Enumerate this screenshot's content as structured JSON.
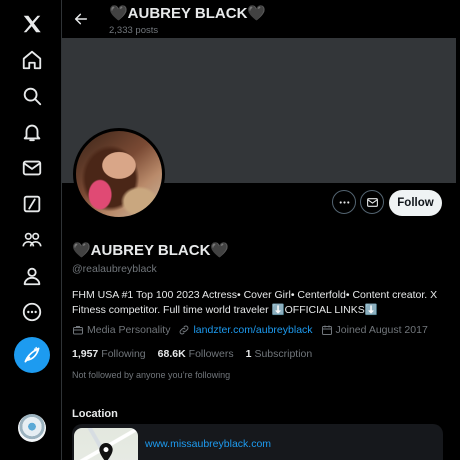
{
  "header": {
    "display_name": "🖤AUBREY BLACK🖤",
    "posts_count": "2,333 posts"
  },
  "profile": {
    "display_name": "🖤AUBREY BLACK🖤",
    "handle": "@realaubreyblack",
    "bio": "FHM USA #1 Top 100 2023 Actress• Cover Girl• Centerfold• Content creator. X Fitness competitor. Full time world traveler ⬇️OFFICIAL LINKS⬇️",
    "category": "Media Personality",
    "website": "landzter.com/aubreyblack",
    "joined": "Joined August 2017",
    "following_count": "1,957",
    "following_label": "Following",
    "followers_count": "68.6K",
    "followers_label": "Followers",
    "subscription_count": "1",
    "subscription_label": "Subscription",
    "not_followed_text": "Not followed by anyone you’re following"
  },
  "actions": {
    "follow_label": "Follow"
  },
  "location": {
    "section_title": "Location",
    "link": "www.missaubreyblack.com"
  },
  "nav": {
    "items": [
      "x-logo-icon",
      "home-icon",
      "explore-icon",
      "notifications-icon",
      "messages-icon",
      "grok-icon",
      "communities-icon",
      "profile-icon",
      "more-icon",
      "post-icon"
    ]
  },
  "colors": {
    "accent": "#1d9bf0",
    "background": "#000000",
    "banner": "#333639",
    "follow_button": "#eff3f4"
  }
}
